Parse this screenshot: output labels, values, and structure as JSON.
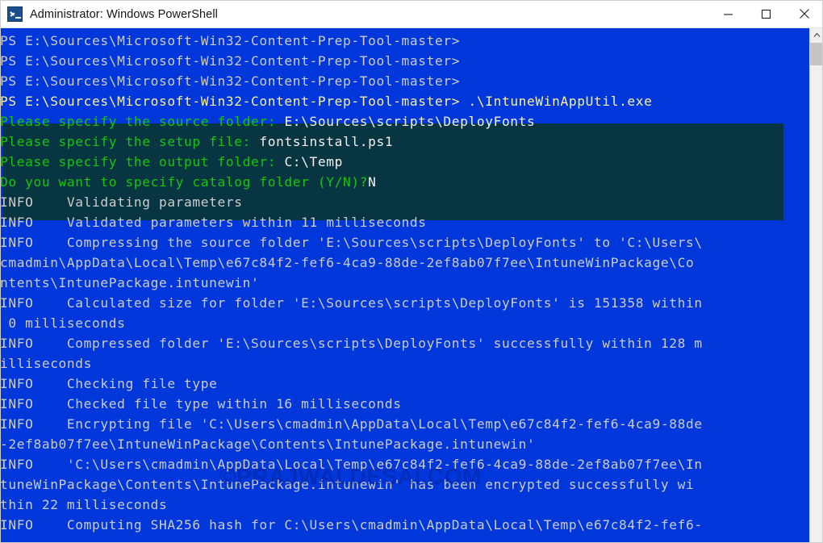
{
  "window": {
    "title": "Administrator: Windows PowerShell",
    "icon": "powershell-icon",
    "minimize_label": "Minimize",
    "maximize_label": "Maximize",
    "close_label": "Close",
    "background_color": "#0037da",
    "selection_color": "#073642",
    "foreground_color": "#cccccc",
    "green_color": "#16c60c",
    "yellow_color": "#f9f1a5"
  },
  "scrollbar": {
    "up_arrow": "scroll-up-arrow",
    "thumb": "scroll-thumb"
  },
  "watermark": {
    "text": "©PRAJWALDESAI.COM"
  },
  "console": {
    "prompt_path": "PS E:\\Sources\\Microsoft-Win32-Content-Prep-Tool-master>",
    "scrollback": [
      "PS E:\\Sources\\Microsoft-Win32-Content-Prep-Tool-master>",
      "PS E:\\Sources\\Microsoft-Win32-Content-Prep-Tool-master>",
      "PS E:\\Sources\\Microsoft-Win32-Content-Prep-Tool-master>"
    ],
    "selected_block": {
      "command_prompt": "PS E:\\Sources\\Microsoft-Win32-Content-Prep-Tool-master> ",
      "command": ".\\IntuneWinAppUtil.exe",
      "prompts": [
        {
          "question": "Please specify the source folder: ",
          "answer": "E:\\Sources\\scripts\\DeployFonts"
        },
        {
          "question": "Please specify the setup file: ",
          "answer": "fontsinstall.ps1"
        },
        {
          "question": "Please specify the output folder: ",
          "answer": "C:\\Temp"
        },
        {
          "question": "Do you want to specify catalog folder (Y/N)?",
          "answer": "N"
        }
      ]
    },
    "output_lines": [
      "INFO    Validating parameters",
      "INFO    Validated parameters within 11 milliseconds",
      "INFO    Compressing the source folder 'E:\\Sources\\scripts\\DeployFonts' to 'C:\\Users\\",
      "cmadmin\\AppData\\Local\\Temp\\e67c84f2-fef6-4ca9-88de-2ef8ab07f7ee\\IntuneWinPackage\\Co",
      "ntents\\IntunePackage.intunewin'",
      "INFO    Calculated size for folder 'E:\\Sources\\scripts\\DeployFonts' is 151358 within",
      " 0 milliseconds",
      "INFO    Compressed folder 'E:\\Sources\\scripts\\DeployFonts' successfully within 128 m",
      "illiseconds",
      "INFO    Checking file type",
      "INFO    Checked file type within 16 milliseconds",
      "INFO    Encrypting file 'C:\\Users\\cmadmin\\AppData\\Local\\Temp\\e67c84f2-fef6-4ca9-88de",
      "-2ef8ab07f7ee\\IntuneWinPackage\\Contents\\IntunePackage.intunewin'",
      "INFO    'C:\\Users\\cmadmin\\AppData\\Local\\Temp\\e67c84f2-fef6-4ca9-88de-2ef8ab07f7ee\\In",
      "tuneWinPackage\\Contents\\IntunePackage.intunewin' has been encrypted successfully wi",
      "thin 22 milliseconds",
      "INFO    Computing SHA256 hash for C:\\Users\\cmadmin\\AppData\\Local\\Temp\\e67c84f2-fef6-"
    ]
  }
}
